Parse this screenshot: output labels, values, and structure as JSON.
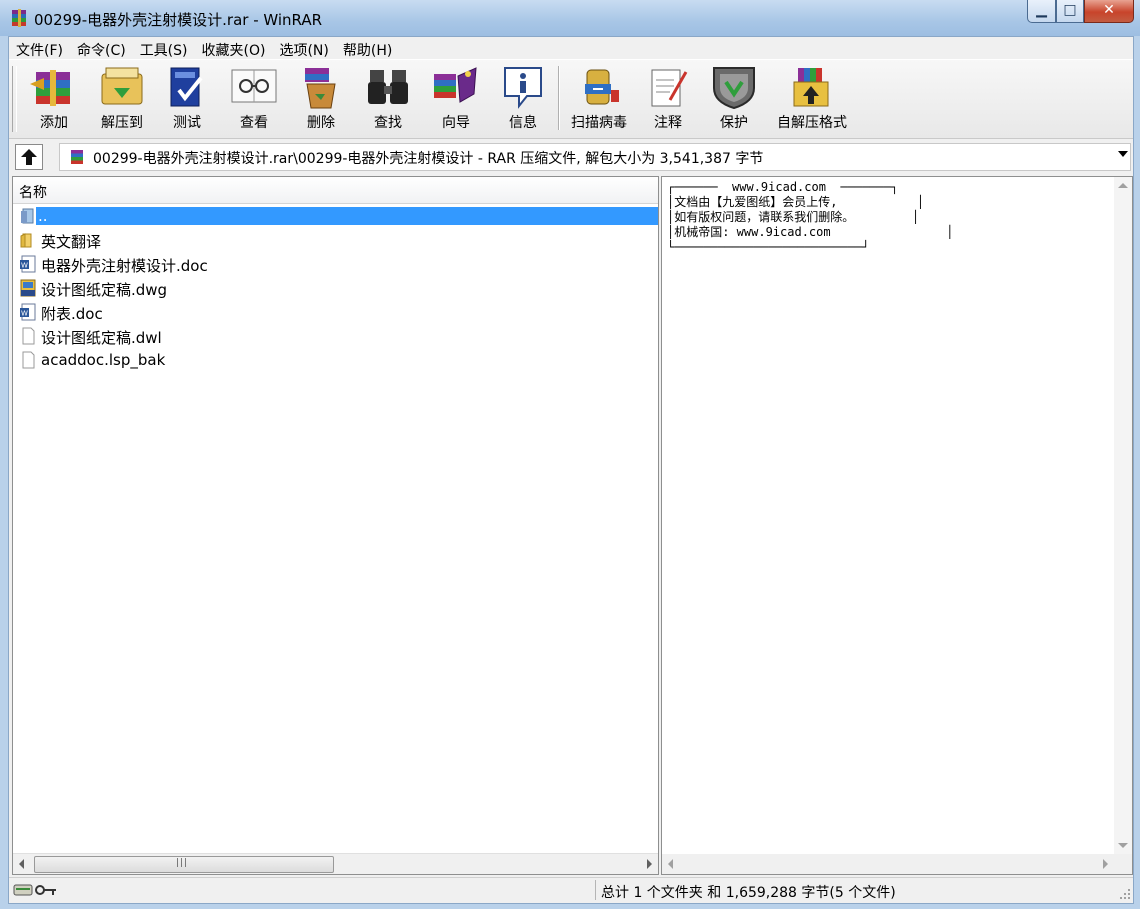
{
  "window": {
    "title": "00299-电器外壳注射模设计.rar - WinRAR"
  },
  "menu": [
    "文件(F)",
    "命令(C)",
    "工具(S)",
    "收藏夹(O)",
    "选项(N)",
    "帮助(H)"
  ],
  "toolbar": {
    "buttons": [
      {
        "label": "添加",
        "icon": "add-archive-icon"
      },
      {
        "label": "解压到",
        "icon": "extract-icon"
      },
      {
        "label": "测试",
        "icon": "test-icon"
      },
      {
        "label": "查看",
        "icon": "view-icon"
      },
      {
        "label": "删除",
        "icon": "delete-icon"
      },
      {
        "label": "查找",
        "icon": "find-icon"
      },
      {
        "label": "向导",
        "icon": "wizard-icon"
      },
      {
        "label": "信息",
        "icon": "info-icon"
      },
      {
        "label": "扫描病毒",
        "icon": "virus-scan-icon"
      },
      {
        "label": "注释",
        "icon": "comment-icon"
      },
      {
        "label": "保护",
        "icon": "protect-icon"
      },
      {
        "label": "自解压格式",
        "icon": "sfx-icon"
      }
    ]
  },
  "address": {
    "path": "00299-电器外壳注射模设计.rar\\00299-电器外壳注射模设计 - RAR 压缩文件, 解包大小为 3,541,387 字节"
  },
  "filelist": {
    "header": "名称",
    "items": [
      {
        "name": "..",
        "icon": "parent-folder-icon",
        "selected": true
      },
      {
        "name": "英文翻译",
        "icon": "folder-icon"
      },
      {
        "name": "电器外壳注射模设计.doc",
        "icon": "word-doc-icon"
      },
      {
        "name": "设计图纸定稿.dwg",
        "icon": "dwg-file-icon"
      },
      {
        "name": "附表.doc",
        "icon": "word-doc-icon"
      },
      {
        "name": "设计图纸定稿.dwl",
        "icon": "blank-file-icon"
      },
      {
        "name": "acaddoc.lsp_bak",
        "icon": "blank-file-icon"
      }
    ]
  },
  "comment": {
    "text": "┌──────  www.9icad.com  ───────┐\n│文档由【九爱图纸】会员上传,           │\n│如有版权问题，请联系我们删除。        │\n│机械帝国: www.9icad.com                │\n└──────────────────────────┘"
  },
  "status": {
    "summary": "总计 1 个文件夹 和 1,659,288 字节(5 个文件)"
  },
  "colors": {
    "selection": "#3399ff",
    "titlebar": "#a8c6e6",
    "close_button": "#c8442b"
  }
}
